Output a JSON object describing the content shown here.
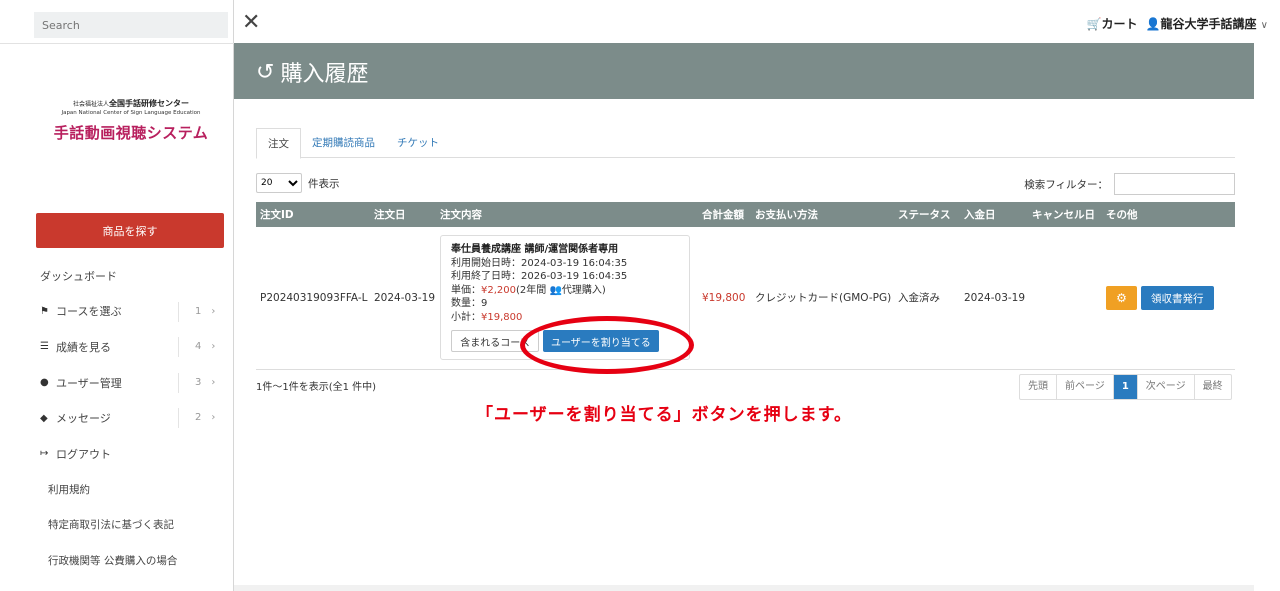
{
  "sidebar": {
    "search_placeholder": "Search",
    "logo_line1_prefix": "社会福祉法人",
    "logo_line1": "全国手話研修センター",
    "logo_en": "Japan National Center of Sign Language Education",
    "logo_main": "手話動画視聴システム",
    "find_button": "商品を探す",
    "items": [
      {
        "label": "ダッシュボード",
        "icon": "none"
      },
      {
        "label": "コースを選ぶ",
        "icon": "flag-icon",
        "count": "1"
      },
      {
        "label": "成績を見る",
        "icon": "chart-icon",
        "count": "4"
      },
      {
        "label": "ユーザー管理",
        "icon": "users-icon",
        "count": "3"
      },
      {
        "label": "メッセージ",
        "icon": "chat-icon",
        "count": "2"
      },
      {
        "label": "ログアウト",
        "icon": "logout-icon"
      }
    ],
    "sub_links": [
      "利用規約",
      "特定商取引法に基づく表記",
      "行政機関等 公費購入の場合"
    ]
  },
  "topbar": {
    "cart_label": "カート",
    "user_label": "龍谷大学手話講座"
  },
  "page": {
    "title": "購入履歴"
  },
  "tabs": [
    "注文",
    "定期購読商品",
    "チケット"
  ],
  "table_controls": {
    "page_length": "20",
    "page_length_suffix": "件表示",
    "filter_label": "検索フィルター："
  },
  "orders_table": {
    "headers": [
      "注文ID",
      "注文日",
      "注文内容",
      "合計金額",
      "お支払い方法",
      "ステータス",
      "入金日",
      "キャンセル日",
      "その他"
    ],
    "rows": [
      {
        "order_id": "P20240319093FFA-L",
        "order_date": "2024-03-19",
        "product_name": "奉仕員養成講座 講師/運営関係者専用",
        "start_label": "利用開始日時：2024-03-19 16:04:35",
        "end_label": "利用終了日時：2026-03-19 16:04:35",
        "unit_price_prefix": "単価：",
        "unit_price": "¥2,200",
        "unit_price_note": "(2年間",
        "unit_price_note2": "代理購入)",
        "quantity": "数量：9",
        "subtotal_prefix": "小計：",
        "subtotal": "¥19,800",
        "included_btn": "含まれるコース",
        "assign_btn": "ユーザーを割り当てる",
        "total": "¥19,800",
        "payment": "クレジットカード(GMO-PG)",
        "status": "入金済み",
        "paid_date": "2024-03-19",
        "cancel_date": "",
        "receipt_btn": "領収書発行"
      }
    ]
  },
  "table_info": "1件～1件を表示(全1 件中)",
  "pagination": [
    "先頭",
    "前ページ",
    "1",
    "次ページ",
    "最終"
  ],
  "annotation": "「ユーザーを割り当てる」ボタンを押します。",
  "colors": {
    "header": "#7c8c8a",
    "accent_red": "#c9392d",
    "primary_blue": "#2a7bbf",
    "orange": "#f0a023",
    "annotation": "#e60012"
  }
}
